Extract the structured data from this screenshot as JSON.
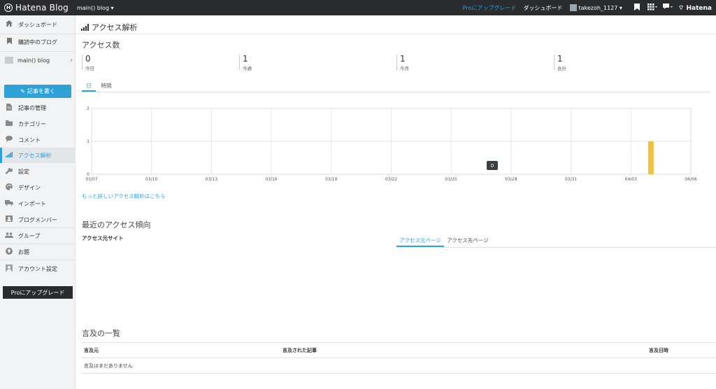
{
  "topbar": {
    "logo_mark": "H",
    "logo_text": "Hatena Blog",
    "blog_switch": "main() blog ▾",
    "pro_upgrade": "Proにアップグレード",
    "dashboard": "ダッシュボード",
    "username": "takezoh_1127 ▾",
    "hatena": "Hatena",
    "icons": [
      "bookmark-icon",
      "grid-icon",
      "comment-icon"
    ]
  },
  "sidebar": {
    "items": [
      {
        "label": "ダッシュボード",
        "icon": "home-icon"
      },
      {
        "label": "購読中のブログ",
        "icon": "bookmark-icon"
      },
      {
        "label": "main() blog",
        "icon": "blog-thumbnail"
      },
      {
        "label": "記事の管理",
        "icon": "document-icon"
      },
      {
        "label": "カテゴリー",
        "icon": "folder-icon"
      },
      {
        "label": "コメント",
        "icon": "speech-bubble-icon"
      },
      {
        "label": "アクセス解析",
        "icon": "signal-bars-icon"
      },
      {
        "label": "設定",
        "icon": "wrench-icon"
      },
      {
        "label": "デザイン",
        "icon": "palette-icon"
      },
      {
        "label": "インポート",
        "icon": "truck-icon"
      },
      {
        "label": "ブログメンバー",
        "icon": "members-icon"
      },
      {
        "label": "グループ",
        "icon": "group-icon"
      },
      {
        "label": "お題",
        "icon": "lightbulb-icon"
      },
      {
        "label": "アカウント設定",
        "icon": "user-icon"
      }
    ],
    "write_button": "記事を書く",
    "pro_button": "Proにアップグレード"
  },
  "page": {
    "title": "アクセス解析",
    "access_heading": "アクセス数",
    "stats": [
      {
        "value": "0",
        "label": "今日"
      },
      {
        "value": "1",
        "label": "今週"
      },
      {
        "value": "1",
        "label": "今月"
      },
      {
        "value": "1",
        "label": "合計"
      }
    ],
    "range_tabs": [
      "日",
      "時間"
    ],
    "detail_link": "もっと詳しいアクセス解析はこちら",
    "trend_heading": "最近のアクセス傾向",
    "source_label": "アクセス元サイト",
    "page_tabs": [
      "アクセス元ページ",
      "アクセス先ページ"
    ],
    "mentions_heading": "言及の一覧",
    "mentions_headers": [
      "言及元",
      "言及された記事",
      "言及日時"
    ],
    "mentions_empty": "言及はまだありません"
  },
  "chart_data": {
    "type": "bar",
    "x_ticks": [
      "03/07",
      "03/10",
      "03/13",
      "03/16",
      "03/19",
      "03/22",
      "03/25",
      "03/28",
      "03/31",
      "04/03",
      "04/06"
    ],
    "y_ticks": [
      "0",
      "1",
      "2"
    ],
    "ylim": [
      0,
      2
    ],
    "bars": [
      {
        "x": "04/04",
        "value": 1
      }
    ],
    "tooltip": "0",
    "bar_color": "#f0c040",
    "grid": true
  }
}
